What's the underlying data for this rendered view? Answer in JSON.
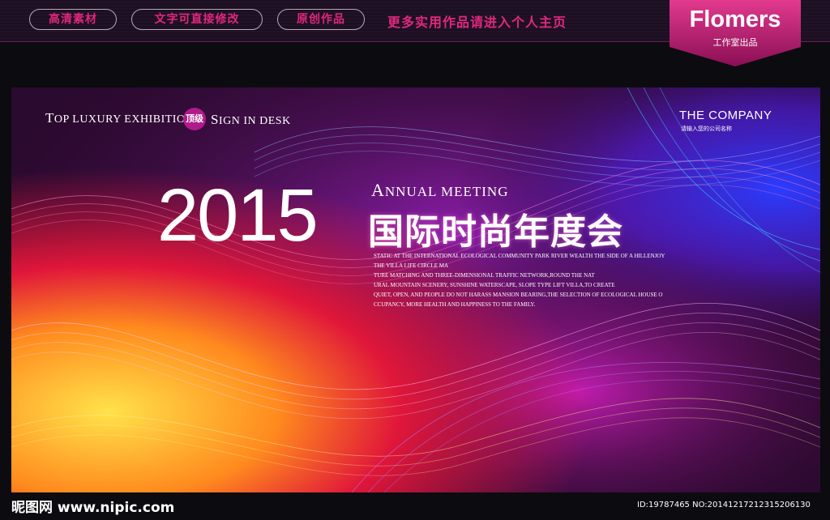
{
  "topbar": {
    "pills": [
      "高清素材",
      "文字可直接修改",
      "原创作品"
    ],
    "promo": "更多实用作品请进入个人主页",
    "brand": "Flomers",
    "brand_sub": "工作室出品"
  },
  "poster": {
    "tagline_top_a": "T",
    "tagline_top_b": "OP LUXURY EXHIBITION",
    "badge": "顶级",
    "tagline_sign_a": "S",
    "tagline_sign_b": "IGN IN DESK",
    "company": "THE COMPANY",
    "company_sub": "请输入您的公司名称",
    "year": "2015",
    "annual_a": "A",
    "annual_b": "NNUAL MEETING",
    "title": "国际时尚年度会",
    "paragraph_lines": [
      "STATIC AT THE INTERNATIONAL ECOLOGICAL COMMUNITY PARK RIVER WEALTH THE SIDE OF A HILLENJOY",
      "THE VILLA LIFE CIRCLE MA",
      "TURE MATCHING AND THREE-DIMENSIONAL TRAFFIC NETWORK,ROUND THE NAT",
      "URAL MOUNTAIN SCENERY, SUNSHINE WATERSCAPE, SLOPE TYPE LIFT VILLA,TO CREATE",
      "QUIET, OPEN, AND PEOPLE DO NOT HARASS MANSION BEARING,THE SELECTION OF ECOLOGICAL HOUSE O",
      "CCUPANCY, MORE HEALTH AND HAPPINESS TO THE FAMILY."
    ]
  },
  "footer": {
    "site": "昵图网 www.nipic.com",
    "id": "ID:19787465 NO:20141217212315206130"
  }
}
